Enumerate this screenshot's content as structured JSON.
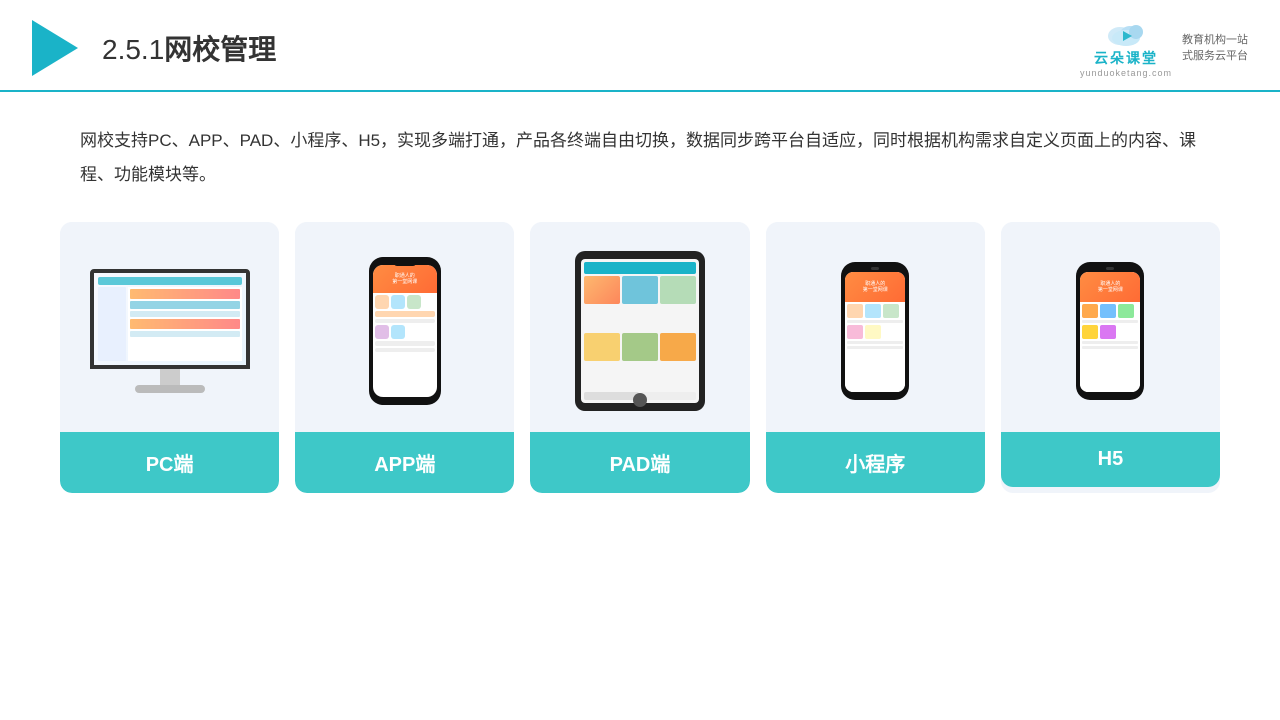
{
  "header": {
    "title_prefix": "2.5.1",
    "title_main": "网校管理"
  },
  "logo": {
    "brand": "云朵课堂",
    "url": "yunduoketang.com",
    "slogan_line1": "教育机构一站",
    "slogan_line2": "式服务云平台"
  },
  "description": "网校支持PC、APP、PAD、小程序、H5，实现多端打通，产品各终端自由切换，数据同步跨平台自适应，同时根据机构需求自定义页面上的内容、课程、功能模块等。",
  "cards": [
    {
      "id": "pc",
      "label": "PC端"
    },
    {
      "id": "app",
      "label": "APP端"
    },
    {
      "id": "pad",
      "label": "PAD端"
    },
    {
      "id": "miniprogram",
      "label": "小程序"
    },
    {
      "id": "h5",
      "label": "H5"
    }
  ]
}
